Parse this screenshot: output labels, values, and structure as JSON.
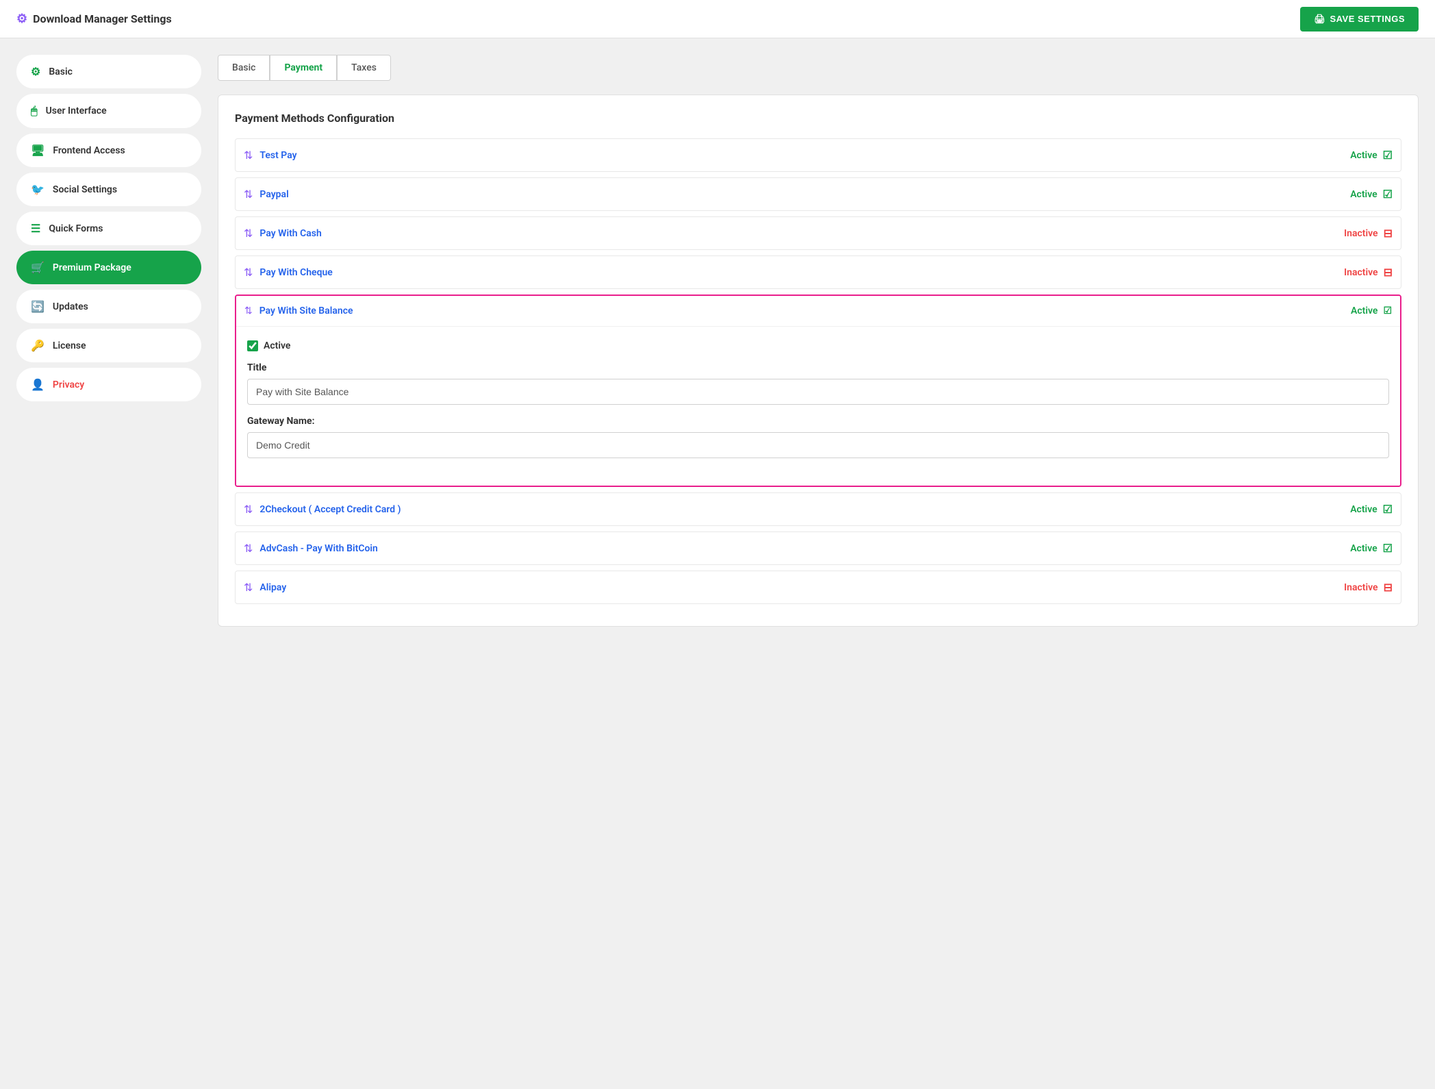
{
  "topbar": {
    "title": "Download Manager Settings",
    "save_button": "SAVE SETTINGS"
  },
  "sidebar": {
    "items": [
      {
        "id": "basic",
        "label": "Basic",
        "icon": "⚙",
        "active": false
      },
      {
        "id": "user-interface",
        "label": "User Interface",
        "icon": "🖱",
        "active": false
      },
      {
        "id": "frontend-access",
        "label": "Frontend Access",
        "icon": "🖥",
        "active": false
      },
      {
        "id": "social-settings",
        "label": "Social Settings",
        "icon": "🐦",
        "active": false
      },
      {
        "id": "quick-forms",
        "label": "Quick Forms",
        "icon": "☰",
        "active": false
      },
      {
        "id": "premium-package",
        "label": "Premium Package",
        "icon": "🛒",
        "active": true
      },
      {
        "id": "updates",
        "label": "Updates",
        "icon": "🔄",
        "active": false
      },
      {
        "id": "license",
        "label": "License",
        "icon": "🔑",
        "active": false
      },
      {
        "id": "privacy",
        "label": "Privacy",
        "icon": "👤",
        "active": false,
        "special": "privacy"
      }
    ]
  },
  "tabs": [
    {
      "id": "basic",
      "label": "Basic",
      "active": false
    },
    {
      "id": "payment",
      "label": "Payment",
      "active": true
    },
    {
      "id": "taxes",
      "label": "Taxes",
      "active": false
    }
  ],
  "payment_config": {
    "title": "Payment Methods Configuration",
    "methods": [
      {
        "id": "test-pay",
        "name": "Test Pay",
        "status": "Active",
        "active": true,
        "expanded": false
      },
      {
        "id": "paypal",
        "name": "Paypal",
        "status": "Active",
        "active": true,
        "expanded": false
      },
      {
        "id": "pay-with-cash",
        "name": "Pay With Cash",
        "status": "Inactive",
        "active": false,
        "expanded": false
      },
      {
        "id": "pay-with-cheque",
        "name": "Pay With Cheque",
        "status": "Inactive",
        "active": false,
        "expanded": false
      },
      {
        "id": "pay-with-site-balance",
        "name": "Pay With Site Balance",
        "status": "Active",
        "active": true,
        "expanded": true,
        "fields": {
          "active_checked": true,
          "active_label": "Active",
          "title_label": "Title",
          "title_value": "Pay with Site Balance",
          "gateway_label": "Gateway Name:",
          "gateway_value": "Demo Credit"
        }
      },
      {
        "id": "2checkout",
        "name": "2Checkout ( Accept Credit Card )",
        "status": "Active",
        "active": true,
        "expanded": false
      },
      {
        "id": "advcash",
        "name": "AdvCash - Pay With BitCoin",
        "status": "Active",
        "active": true,
        "expanded": false
      },
      {
        "id": "alipay",
        "name": "Alipay",
        "status": "Inactive",
        "active": false,
        "expanded": false
      }
    ]
  },
  "colors": {
    "green": "#16a34a",
    "blue": "#2563eb",
    "purple": "#8b5cf6",
    "red": "#ef4444",
    "pink_border": "#e91e8c"
  }
}
